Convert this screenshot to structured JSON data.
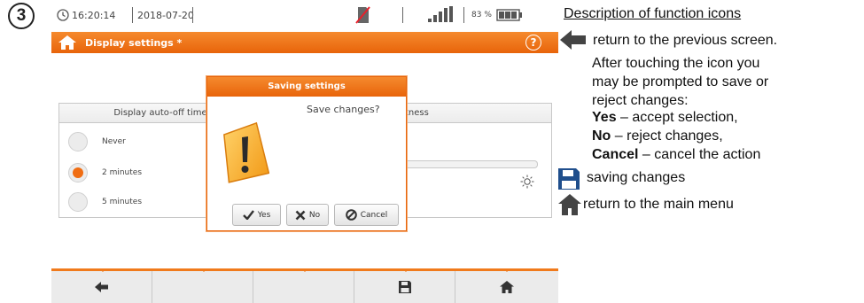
{
  "step_number": "3",
  "status": {
    "time": "16:20:14",
    "date": "2018-07-20",
    "battery_percent": "83 %"
  },
  "title_bar": {
    "title": "Display settings *",
    "help_icon": "?"
  },
  "auto_off_panel": {
    "header": "Display auto-off time",
    "options": [
      {
        "label": "Never",
        "selected": false
      },
      {
        "label": "2 minutes",
        "selected": true
      },
      {
        "label": "5 minutes",
        "selected": false
      }
    ]
  },
  "brightness_panel": {
    "header_fragment": "tness"
  },
  "dialog": {
    "title": "Saving settings",
    "message": "Save changes?",
    "buttons": {
      "yes": "Yes",
      "no": "No",
      "cancel": "Cancel"
    }
  },
  "bottom_bar": {
    "buttons": [
      "back-arrow-icon",
      "",
      "",
      "save-icon",
      "home-icon"
    ]
  },
  "description": {
    "title": "Description of function icons",
    "back_line": "return to the previous screen.",
    "back_para_lines": [
      "After touching the icon you",
      "may be prompted to save or",
      "reject changes:"
    ],
    "options": [
      {
        "key": "Yes",
        "text": "– accept selection,"
      },
      {
        "key": "No",
        "text": "– reject changes,"
      },
      {
        "key": "Cancel",
        "text": "– cancel the action"
      }
    ],
    "save_line": "saving changes",
    "home_line": "return to the main menu"
  },
  "colors": {
    "accent": "#f07a1c",
    "accent_dark": "#e8640a"
  }
}
